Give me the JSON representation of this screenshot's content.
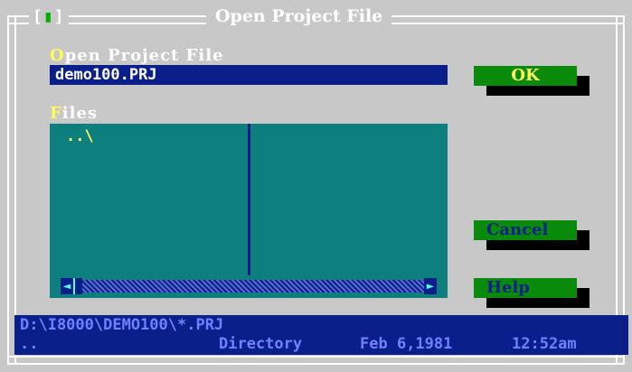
{
  "dialog": {
    "title": "Open Project File",
    "close_box": {
      "left": "[",
      "mark": "▮",
      "right": "]"
    }
  },
  "file_field": {
    "label_hotkey": "O",
    "label_rest": "pen Project File",
    "value": "demo100.PRJ"
  },
  "files": {
    "label_hotkey": "F",
    "label_rest": "iles",
    "items": [
      "..\\"
    ],
    "scrollbar": {
      "left_arrow": "◄",
      "right_arrow": "►"
    }
  },
  "buttons": {
    "ok": "OK",
    "cancel": "Cancel",
    "help": "Help"
  },
  "status": {
    "path": "D:\\I8000\\DEMO100\\*.PRJ",
    "selected_name": "..",
    "selected_type": "Directory",
    "selected_date": "Feb 6,1981",
    "selected_time": "12:52am"
  }
}
